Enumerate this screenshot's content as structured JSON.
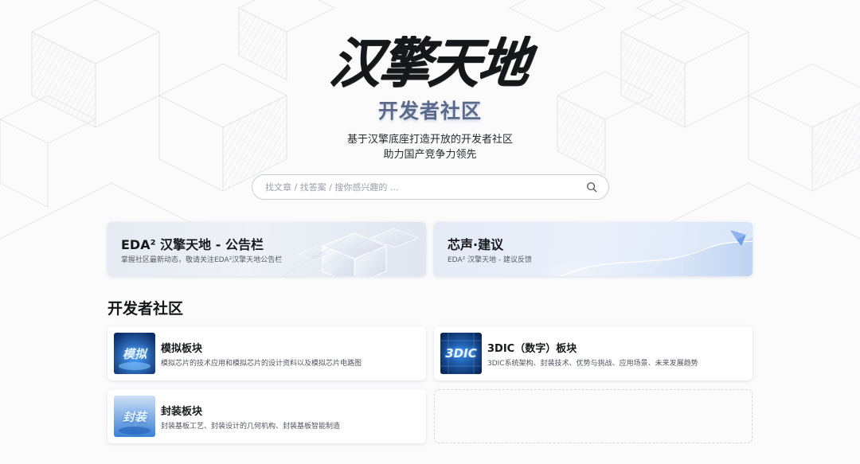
{
  "header": {
    "logo_text": "汉擎天地",
    "subtitle": "开发者社区",
    "tagline_1": "基于汉擎底座打造开放的开发者社区",
    "tagline_2": "助力国产竞争力领先"
  },
  "search": {
    "placeholder": "找文章 / 找答案 / 搜你感兴趣的 ...",
    "value": ""
  },
  "banners": [
    {
      "title": "EDA² 汉擎天地 - 公告栏",
      "desc": "掌握社区最新动态，敬请关注EDA²汉擎天地公告栏"
    },
    {
      "title": "芯声·建议",
      "desc": "EDA² 汉擎天地 - 建议反馈"
    }
  ],
  "section": {
    "title": "开发者社区"
  },
  "cards": [
    {
      "thumb": "模拟",
      "title": "模拟板块",
      "desc": "模拟芯片的技术应用和模拟芯片的设计资料以及模拟芯片电路图"
    },
    {
      "thumb": "3DIC",
      "title": "3DIC（数字）板块",
      "desc": "3DIC系统架构、封装技术、优势与挑战、应用场景、未来发展趋势"
    },
    {
      "thumb": "封装",
      "title": "封装板块",
      "desc": "封装基板工艺、封装设计的几何机构、封装基板智能制造"
    }
  ],
  "colors": {
    "accent": "#3c7be0",
    "subtitle": "#5a6a8a",
    "border": "#c9ced6"
  },
  "icons": {
    "search": "search-icon"
  }
}
